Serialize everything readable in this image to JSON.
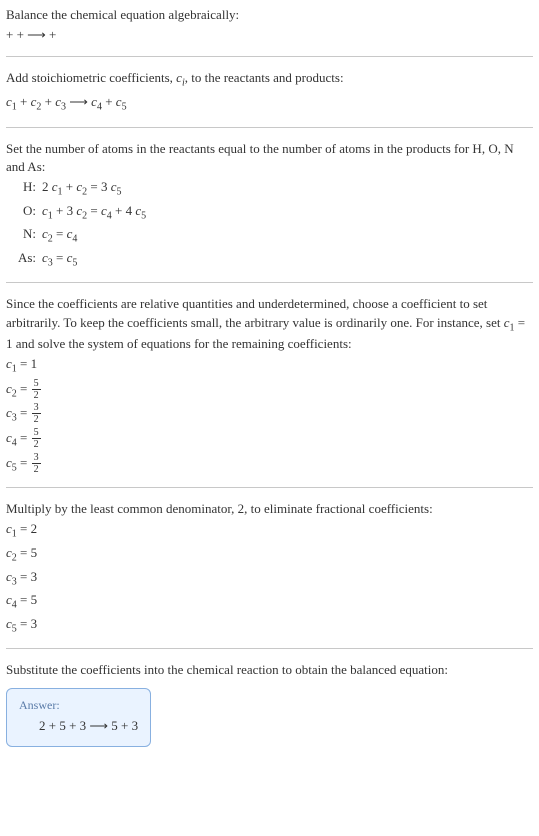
{
  "intro": {
    "line1": "Balance the chemical equation algebraically:",
    "line2": " +  +  ⟶  + "
  },
  "stoich": {
    "line1": "Add stoichiometric coefficients, ",
    "ci": "c",
    "cisub": "i",
    "line1b": ", to the reactants and products:",
    "eq_prefix": "c",
    "eq": "  +   +   ⟶   + "
  },
  "atoms": {
    "intro1": "Set the number of atoms in the reactants equal to the number of atoms in the products for H, O, N and As:",
    "rows": [
      {
        "el": "H:",
        "eq_parts": [
          "2 ",
          "c",
          "1",
          " + ",
          "c",
          "2",
          " = 3 ",
          "c",
          "5"
        ]
      },
      {
        "el": "O:",
        "eq_parts": [
          "",
          "c",
          "1",
          " + 3 ",
          "c",
          "2",
          " = ",
          "c",
          "4",
          " + 4 ",
          "c",
          "5"
        ]
      },
      {
        "el": "N:",
        "eq_parts": [
          "",
          "c",
          "2",
          " = ",
          "c",
          "4"
        ]
      },
      {
        "el": "As:",
        "eq_parts": [
          "",
          "c",
          "3",
          " = ",
          "c",
          "5"
        ]
      }
    ]
  },
  "relative": {
    "text": "Since the coefficients are relative quantities and underdetermined, choose a coefficient to set arbitrarily. To keep the coefficients small, the arbitrary value is ordinarily one. For instance, set ",
    "c1var": "c",
    "c1sub": "1",
    "text2": " = 1 and solve the system of equations for the remaining coefficients:"
  },
  "fraccoeffs": [
    {
      "var": "c",
      "sub": "1",
      "val": "1",
      "isfrac": false
    },
    {
      "var": "c",
      "sub": "2",
      "num": "5",
      "den": "2",
      "isfrac": true
    },
    {
      "var": "c",
      "sub": "3",
      "num": "3",
      "den": "2",
      "isfrac": true
    },
    {
      "var": "c",
      "sub": "4",
      "num": "5",
      "den": "2",
      "isfrac": true
    },
    {
      "var": "c",
      "sub": "5",
      "num": "3",
      "den": "2",
      "isfrac": true
    }
  ],
  "lcd": {
    "text": "Multiply by the least common denominator, 2, to eliminate fractional coefficients:"
  },
  "intcoeffs": [
    {
      "var": "c",
      "sub": "1",
      "val": "2"
    },
    {
      "var": "c",
      "sub": "2",
      "val": "5"
    },
    {
      "var": "c",
      "sub": "3",
      "val": "3"
    },
    {
      "var": "c",
      "sub": "4",
      "val": "5"
    },
    {
      "var": "c",
      "sub": "5",
      "val": "3"
    }
  ],
  "final": {
    "text": "Substitute the coefficients into the chemical reaction to obtain the balanced equation:"
  },
  "answer": {
    "label": "Answer:",
    "body": "2  + 5  + 3  ⟶ 5  + 3 "
  }
}
